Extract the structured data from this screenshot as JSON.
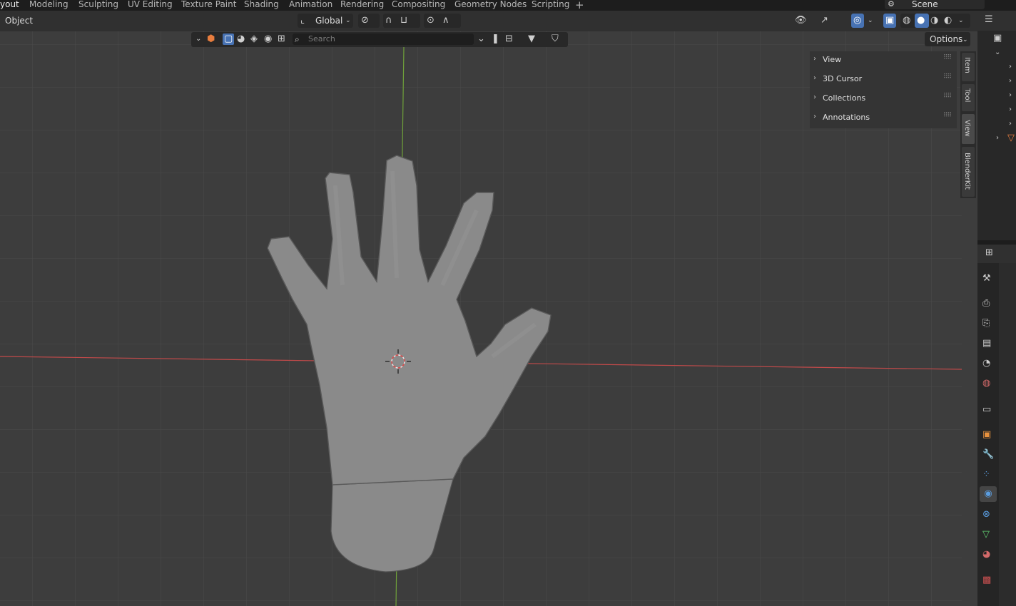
{
  "workspace_tabs": [
    "yout",
    "Modeling",
    "Sculpting",
    "UV Editing",
    "Texture Paint",
    "Shading",
    "Animation",
    "Rendering",
    "Compositing",
    "Geometry Nodes",
    "Scripting"
  ],
  "active_tab": "yout",
  "add_workspace": "+",
  "scene_name": "Scene",
  "header": {
    "mode": "Object",
    "transform_orientation": "Global"
  },
  "toolbar": {
    "search_placeholder": "Search",
    "options_label": "Options"
  },
  "n_panel": {
    "sections": [
      "View",
      "3D Cursor",
      "Collections",
      "Annotations"
    ],
    "tabs": [
      "Item",
      "Tool",
      "View",
      "BlenderKit"
    ],
    "active_tab": "View"
  },
  "colors": {
    "x_axis": "#c24a4a",
    "y_axis": "#6fa13a",
    "selected_blue": "#4772b3",
    "mesh_gray": "#8a8a8a"
  },
  "properties_icons": [
    "tool-icon",
    "render-icon",
    "output-icon",
    "view-layer-icon",
    "scene-icon",
    "world-icon",
    "collection-icon",
    "object-icon",
    "modifier-icon",
    "particles-icon",
    "physics-icon",
    "constraints-icon",
    "data-icon",
    "material-icon",
    "texture-icon"
  ],
  "properties_active": "physics-icon"
}
